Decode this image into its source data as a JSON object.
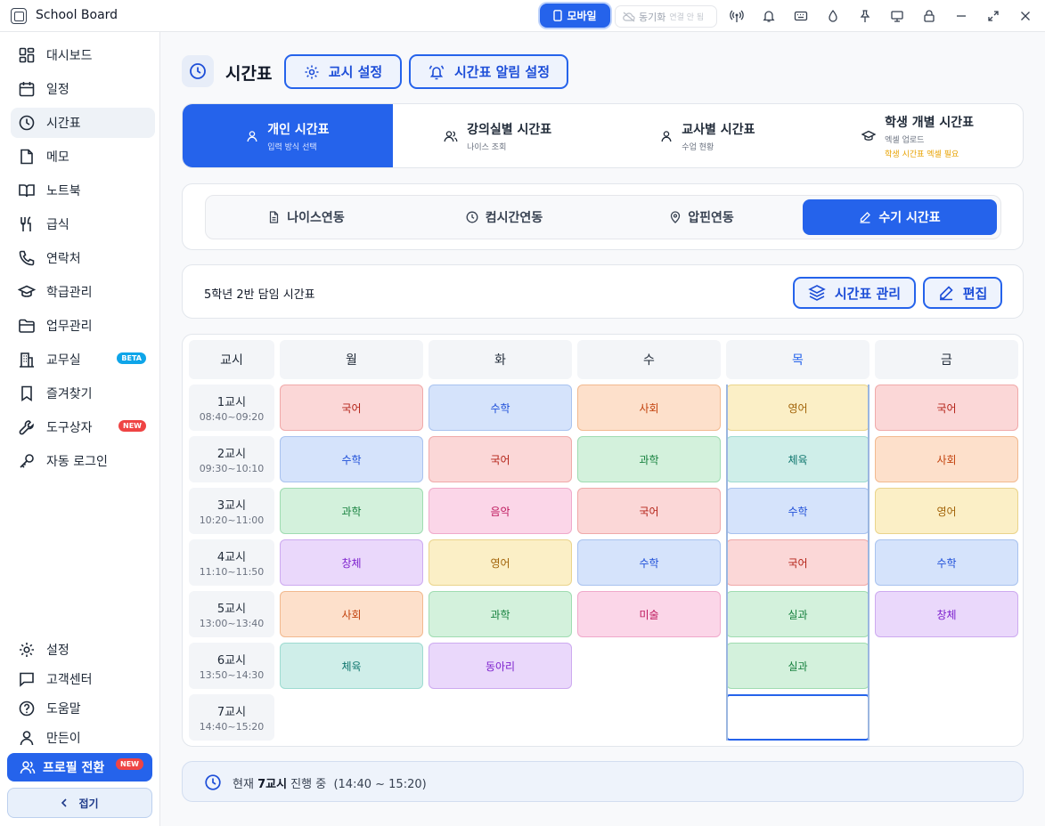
{
  "app": {
    "title": "School Board"
  },
  "titlebar": {
    "mobile_label": "모바일",
    "sync_label": "동기화",
    "sync_status": "연결 안 됨"
  },
  "sidebar": {
    "items": [
      {
        "label": "대시보드",
        "icon": "dashboard-icon"
      },
      {
        "label": "일정",
        "icon": "calendar-icon"
      },
      {
        "label": "시간표",
        "icon": "clock-icon"
      },
      {
        "label": "메모",
        "icon": "memo-icon"
      },
      {
        "label": "노트북",
        "icon": "book-icon"
      },
      {
        "label": "급식",
        "icon": "utensils-icon"
      },
      {
        "label": "연락처",
        "icon": "phone-icon"
      },
      {
        "label": "학급관리",
        "icon": "graduation-cap-icon"
      },
      {
        "label": "업무관리",
        "icon": "folder-icon"
      },
      {
        "label": "교무실",
        "icon": "building-icon",
        "badge": "BETA"
      },
      {
        "label": "즐겨찾기",
        "icon": "bookmark-icon"
      },
      {
        "label": "도구상자",
        "icon": "wrench-icon",
        "badge": "NEW"
      },
      {
        "label": "자동 로그인",
        "icon": "key-icon"
      }
    ],
    "bottom_items": [
      {
        "label": "설정",
        "icon": "gear-icon"
      },
      {
        "label": "고객센터",
        "icon": "chat-icon"
      },
      {
        "label": "도움말",
        "icon": "help-icon"
      },
      {
        "label": "만든이",
        "icon": "user-icon"
      }
    ],
    "profile_label": "프로필 전환",
    "profile_badge": "NEW",
    "collapse_label": "접기"
  },
  "page": {
    "title": "시간표",
    "period_settings": "교시 설정",
    "alarm_settings": "시간표 알림 설정"
  },
  "modes": [
    {
      "title": "개인 시간표",
      "sub": "입력 방식 선택",
      "icon": "user-icon"
    },
    {
      "title": "강의실별 시간표",
      "sub": "나이스 조회",
      "icon": "users-icon"
    },
    {
      "title": "교사별 시간표",
      "sub": "수업 현황",
      "icon": "user-icon"
    },
    {
      "title": "학생 개별 시간표",
      "sub": "엑셀 업로드",
      "warn": "학생 시간표 엑셀 필요",
      "icon": "graduation-cap-icon"
    }
  ],
  "sources": [
    {
      "label": "나이스연동",
      "icon": "file-icon"
    },
    {
      "label": "컴시간연동",
      "icon": "clock-icon"
    },
    {
      "label": "압핀연동",
      "icon": "pin-icon"
    },
    {
      "label": "수기 시간표",
      "icon": "pencil-icon"
    }
  ],
  "info": {
    "class_label": "5학년 2반 담임 시간표",
    "manage_label": "시간표 관리",
    "edit_label": "편집"
  },
  "timetable": {
    "period_header": "교시",
    "days": [
      "월",
      "화",
      "수",
      "목",
      "금"
    ],
    "today_index": 3,
    "periods": [
      {
        "name": "1교시",
        "time": "08:40~09:20"
      },
      {
        "name": "2교시",
        "time": "09:30~10:10"
      },
      {
        "name": "3교시",
        "time": "10:20~11:00"
      },
      {
        "name": "4교시",
        "time": "11:10~11:50"
      },
      {
        "name": "5교시",
        "time": "13:00~13:40"
      },
      {
        "name": "6교시",
        "time": "13:50~14:30"
      },
      {
        "name": "7교시",
        "time": "14:40~15:20"
      }
    ],
    "cells": [
      [
        "국어",
        "수학",
        "사회",
        "영어",
        "국어"
      ],
      [
        "수학",
        "국어",
        "과학",
        "체육",
        "사회"
      ],
      [
        "과학",
        "음악",
        "국어",
        "수학",
        "영어"
      ],
      [
        "창체",
        "영어",
        "수학",
        "국어",
        "수학"
      ],
      [
        "사회",
        "과학",
        "미술",
        "실과",
        "창체"
      ],
      [
        "체육",
        "동아리",
        "",
        "실과",
        ""
      ],
      [
        "",
        "",
        "",
        "",
        ""
      ]
    ]
  },
  "status": {
    "prefix": "현재",
    "period": "7교시",
    "suffix": "진행 중",
    "range": "(14:40 ~ 15:20)"
  }
}
